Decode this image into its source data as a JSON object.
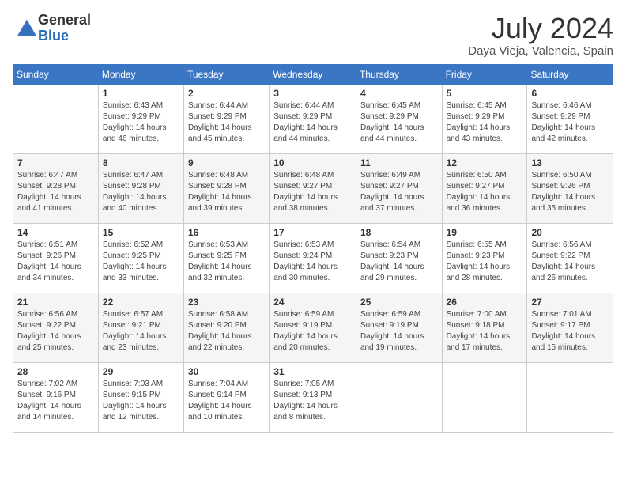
{
  "logo": {
    "general": "General",
    "blue": "Blue"
  },
  "header": {
    "month_year": "July 2024",
    "location": "Daya Vieja, Valencia, Spain"
  },
  "weekdays": [
    "Sunday",
    "Monday",
    "Tuesday",
    "Wednesday",
    "Thursday",
    "Friday",
    "Saturday"
  ],
  "weeks": [
    [
      {
        "day": "",
        "sunrise": "",
        "sunset": "",
        "daylight": ""
      },
      {
        "day": "1",
        "sunrise": "Sunrise: 6:43 AM",
        "sunset": "Sunset: 9:29 PM",
        "daylight": "Daylight: 14 hours and 46 minutes."
      },
      {
        "day": "2",
        "sunrise": "Sunrise: 6:44 AM",
        "sunset": "Sunset: 9:29 PM",
        "daylight": "Daylight: 14 hours and 45 minutes."
      },
      {
        "day": "3",
        "sunrise": "Sunrise: 6:44 AM",
        "sunset": "Sunset: 9:29 PM",
        "daylight": "Daylight: 14 hours and 44 minutes."
      },
      {
        "day": "4",
        "sunrise": "Sunrise: 6:45 AM",
        "sunset": "Sunset: 9:29 PM",
        "daylight": "Daylight: 14 hours and 44 minutes."
      },
      {
        "day": "5",
        "sunrise": "Sunrise: 6:45 AM",
        "sunset": "Sunset: 9:29 PM",
        "daylight": "Daylight: 14 hours and 43 minutes."
      },
      {
        "day": "6",
        "sunrise": "Sunrise: 6:46 AM",
        "sunset": "Sunset: 9:29 PM",
        "daylight": "Daylight: 14 hours and 42 minutes."
      }
    ],
    [
      {
        "day": "7",
        "sunrise": "Sunrise: 6:47 AM",
        "sunset": "Sunset: 9:28 PM",
        "daylight": "Daylight: 14 hours and 41 minutes."
      },
      {
        "day": "8",
        "sunrise": "Sunrise: 6:47 AM",
        "sunset": "Sunset: 9:28 PM",
        "daylight": "Daylight: 14 hours and 40 minutes."
      },
      {
        "day": "9",
        "sunrise": "Sunrise: 6:48 AM",
        "sunset": "Sunset: 9:28 PM",
        "daylight": "Daylight: 14 hours and 39 minutes."
      },
      {
        "day": "10",
        "sunrise": "Sunrise: 6:48 AM",
        "sunset": "Sunset: 9:27 PM",
        "daylight": "Daylight: 14 hours and 38 minutes."
      },
      {
        "day": "11",
        "sunrise": "Sunrise: 6:49 AM",
        "sunset": "Sunset: 9:27 PM",
        "daylight": "Daylight: 14 hours and 37 minutes."
      },
      {
        "day": "12",
        "sunrise": "Sunrise: 6:50 AM",
        "sunset": "Sunset: 9:27 PM",
        "daylight": "Daylight: 14 hours and 36 minutes."
      },
      {
        "day": "13",
        "sunrise": "Sunrise: 6:50 AM",
        "sunset": "Sunset: 9:26 PM",
        "daylight": "Daylight: 14 hours and 35 minutes."
      }
    ],
    [
      {
        "day": "14",
        "sunrise": "Sunrise: 6:51 AM",
        "sunset": "Sunset: 9:26 PM",
        "daylight": "Daylight: 14 hours and 34 minutes."
      },
      {
        "day": "15",
        "sunrise": "Sunrise: 6:52 AM",
        "sunset": "Sunset: 9:25 PM",
        "daylight": "Daylight: 14 hours and 33 minutes."
      },
      {
        "day": "16",
        "sunrise": "Sunrise: 6:53 AM",
        "sunset": "Sunset: 9:25 PM",
        "daylight": "Daylight: 14 hours and 32 minutes."
      },
      {
        "day": "17",
        "sunrise": "Sunrise: 6:53 AM",
        "sunset": "Sunset: 9:24 PM",
        "daylight": "Daylight: 14 hours and 30 minutes."
      },
      {
        "day": "18",
        "sunrise": "Sunrise: 6:54 AM",
        "sunset": "Sunset: 9:23 PM",
        "daylight": "Daylight: 14 hours and 29 minutes."
      },
      {
        "day": "19",
        "sunrise": "Sunrise: 6:55 AM",
        "sunset": "Sunset: 9:23 PM",
        "daylight": "Daylight: 14 hours and 28 minutes."
      },
      {
        "day": "20",
        "sunrise": "Sunrise: 6:56 AM",
        "sunset": "Sunset: 9:22 PM",
        "daylight": "Daylight: 14 hours and 26 minutes."
      }
    ],
    [
      {
        "day": "21",
        "sunrise": "Sunrise: 6:56 AM",
        "sunset": "Sunset: 9:22 PM",
        "daylight": "Daylight: 14 hours and 25 minutes."
      },
      {
        "day": "22",
        "sunrise": "Sunrise: 6:57 AM",
        "sunset": "Sunset: 9:21 PM",
        "daylight": "Daylight: 14 hours and 23 minutes."
      },
      {
        "day": "23",
        "sunrise": "Sunrise: 6:58 AM",
        "sunset": "Sunset: 9:20 PM",
        "daylight": "Daylight: 14 hours and 22 minutes."
      },
      {
        "day": "24",
        "sunrise": "Sunrise: 6:59 AM",
        "sunset": "Sunset: 9:19 PM",
        "daylight": "Daylight: 14 hours and 20 minutes."
      },
      {
        "day": "25",
        "sunrise": "Sunrise: 6:59 AM",
        "sunset": "Sunset: 9:19 PM",
        "daylight": "Daylight: 14 hours and 19 minutes."
      },
      {
        "day": "26",
        "sunrise": "Sunrise: 7:00 AM",
        "sunset": "Sunset: 9:18 PM",
        "daylight": "Daylight: 14 hours and 17 minutes."
      },
      {
        "day": "27",
        "sunrise": "Sunrise: 7:01 AM",
        "sunset": "Sunset: 9:17 PM",
        "daylight": "Daylight: 14 hours and 15 minutes."
      }
    ],
    [
      {
        "day": "28",
        "sunrise": "Sunrise: 7:02 AM",
        "sunset": "Sunset: 9:16 PM",
        "daylight": "Daylight: 14 hours and 14 minutes."
      },
      {
        "day": "29",
        "sunrise": "Sunrise: 7:03 AM",
        "sunset": "Sunset: 9:15 PM",
        "daylight": "Daylight: 14 hours and 12 minutes."
      },
      {
        "day": "30",
        "sunrise": "Sunrise: 7:04 AM",
        "sunset": "Sunset: 9:14 PM",
        "daylight": "Daylight: 14 hours and 10 minutes."
      },
      {
        "day": "31",
        "sunrise": "Sunrise: 7:05 AM",
        "sunset": "Sunset: 9:13 PM",
        "daylight": "Daylight: 14 hours and 8 minutes."
      },
      {
        "day": "",
        "sunrise": "",
        "sunset": "",
        "daylight": ""
      },
      {
        "day": "",
        "sunrise": "",
        "sunset": "",
        "daylight": ""
      },
      {
        "day": "",
        "sunrise": "",
        "sunset": "",
        "daylight": ""
      }
    ]
  ]
}
